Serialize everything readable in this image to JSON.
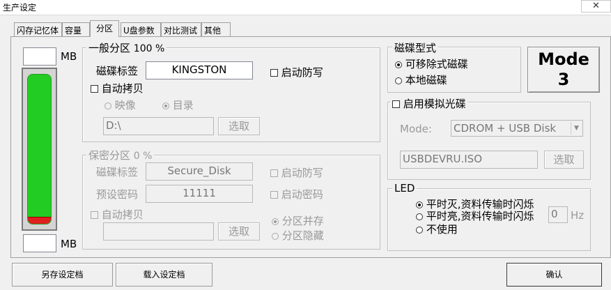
{
  "window": {
    "title": "生产设定",
    "close_icon": "✕"
  },
  "tabs": [
    {
      "label": "闪存记忆体"
    },
    {
      "label": "容量"
    },
    {
      "label": "分区"
    },
    {
      "label": "U盘参数"
    },
    {
      "label": "对比测试"
    },
    {
      "label": "其他"
    }
  ],
  "capacity": {
    "top_value": "",
    "bottom_value": "",
    "unit": "MB"
  },
  "general_partition": {
    "title": "一般分区",
    "percent": "100 %",
    "label_caption": "磁碟标签",
    "label_value": "KINGSTON",
    "write_protect": "启动防写",
    "auto_copy": "自动拷贝",
    "image_option": "映像",
    "dir_option": "目录",
    "path_value": "D:\\",
    "browse_label": "选取"
  },
  "secure_partition": {
    "title": "保密分区",
    "percent": "0 %",
    "label_caption": "磁碟标签",
    "label_value": "Secure_Disk",
    "password_caption": "预设密码",
    "password_value": "11111",
    "write_protect": "启动防写",
    "enable_password": "启动密码",
    "auto_copy": "自动拷贝",
    "path_value": "",
    "browse_label": "选取",
    "coexist_option": "分区并存",
    "hide_option": "分区隐藏"
  },
  "disk_type": {
    "title": "磁碟型式",
    "removable": "可移除式磁碟",
    "local": "本地磁碟"
  },
  "mode_button": {
    "line1": "Mode",
    "line2": "3"
  },
  "cdrom": {
    "title": "启用模拟光碟",
    "mode_caption": "Mode:",
    "mode_value": "CDROM + USB Disk",
    "iso_value": "USBDEVRU.ISO",
    "browse_label": "选取"
  },
  "led": {
    "title": "LED",
    "option1": "平时灭,资料传输时闪烁",
    "option2": "平时亮,资料传输时闪烁",
    "option3": "不使用",
    "hz_value": "0",
    "hz_unit": "Hz"
  },
  "footer": {
    "save_label": "另存设定档",
    "load_label": "载入设定档",
    "ok_label": "确认"
  },
  "colors": {
    "gauge_fill": "#22cc22",
    "gauge_low": "#e02020"
  },
  "gauge": {
    "used_fraction": 0.96
  }
}
